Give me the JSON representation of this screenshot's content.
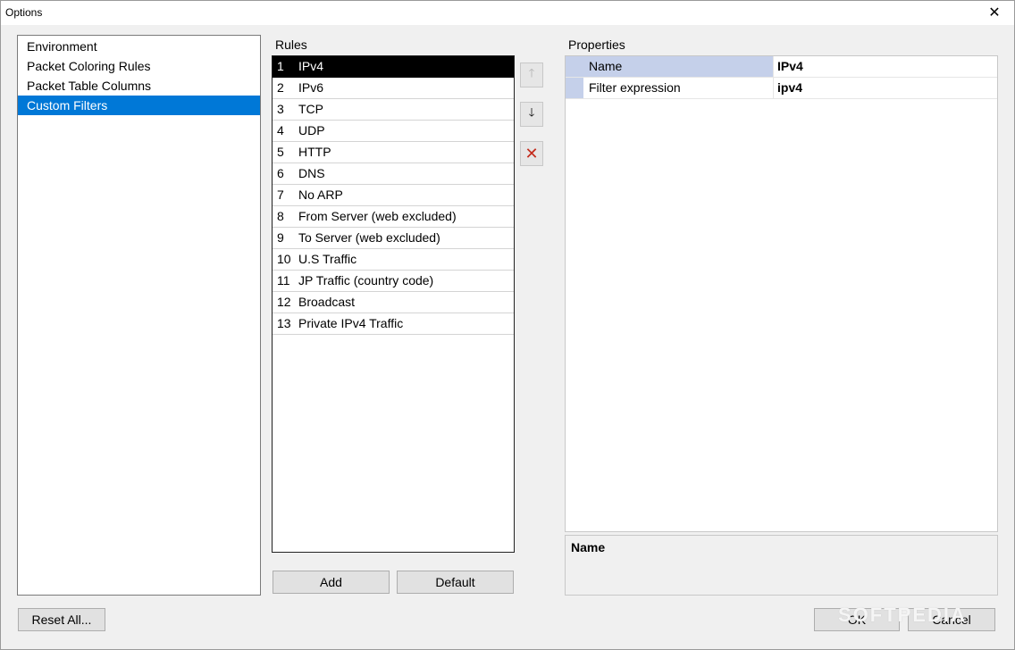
{
  "window": {
    "title": "Options",
    "close_glyph": "✕"
  },
  "nav": {
    "items": [
      {
        "label": "Environment"
      },
      {
        "label": "Packet Coloring Rules"
      },
      {
        "label": "Packet Table Columns"
      },
      {
        "label": "Custom Filters",
        "selected": true
      }
    ]
  },
  "rules": {
    "label": "Rules",
    "items": [
      {
        "num": "1",
        "name": "IPv4"
      },
      {
        "num": "2",
        "name": "IPv6"
      },
      {
        "num": "3",
        "name": "TCP"
      },
      {
        "num": "4",
        "name": "UDP"
      },
      {
        "num": "5",
        "name": "HTTP"
      },
      {
        "num": "6",
        "name": "DNS"
      },
      {
        "num": "7",
        "name": "No ARP"
      },
      {
        "num": "8",
        "name": "From Server (web excluded)"
      },
      {
        "num": "9",
        "name": "To Server (web excluded)"
      },
      {
        "num": "10",
        "name": "U.S Traffic"
      },
      {
        "num": "11",
        "name": "JP Traffic (country code)"
      },
      {
        "num": "12",
        "name": "Broadcast"
      },
      {
        "num": "13",
        "name": "Private IPv4 Traffic"
      }
    ],
    "selected_index": 0,
    "add_label": "Add",
    "default_label": "Default"
  },
  "side_buttons": {
    "up": "🡑",
    "down": "🡓",
    "delete": "✕"
  },
  "properties": {
    "label": "Properties",
    "rows": [
      {
        "key": "Name",
        "value": "IPv4"
      },
      {
        "key": "Filter expression",
        "value": "ipv4"
      }
    ],
    "description_title": "Name"
  },
  "footer": {
    "reset_label": "Reset All...",
    "ok_label": "OK",
    "cancel_label": "Cancel"
  },
  "watermark": "SOFTPEDIA",
  "colors": {
    "selection": "#0078d7",
    "property_highlight": "#c5d0ea",
    "delete": "#c42b1c"
  }
}
